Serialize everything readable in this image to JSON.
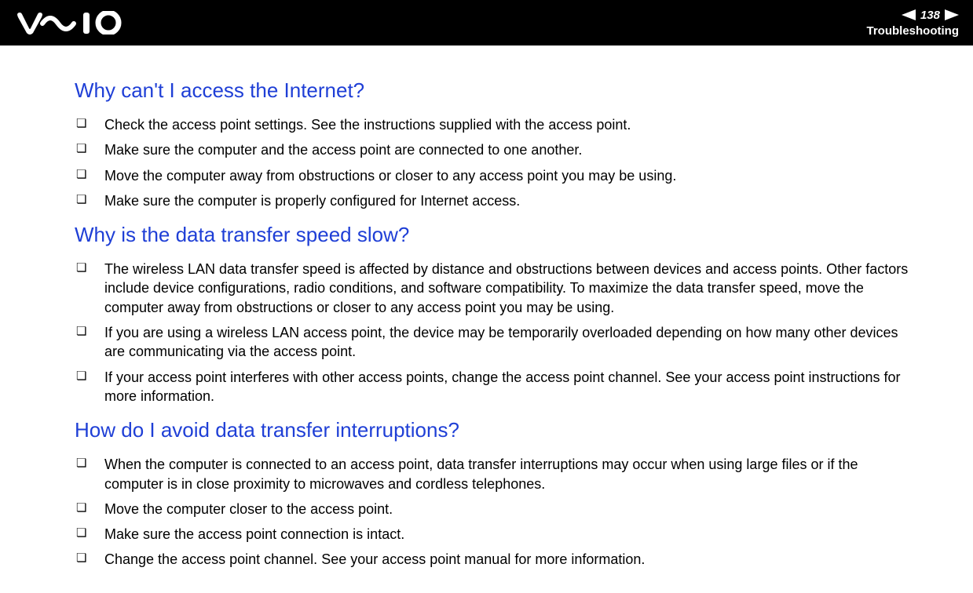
{
  "header": {
    "page_number": "138",
    "section": "Troubleshooting"
  },
  "sections": [
    {
      "heading": "Why can't I access the Internet?",
      "items": [
        "Check the access point settings. See the instructions supplied with the access point.",
        "Make sure the computer and the access point are connected to one another.",
        "Move the computer away from obstructions or closer to any access point you may be using.",
        "Make sure the computer is properly configured for Internet access."
      ]
    },
    {
      "heading": "Why is the data transfer speed slow?",
      "items": [
        "The wireless LAN data transfer speed is affected by distance and obstructions between devices and access points. Other factors include device configurations, radio conditions, and software compatibility. To maximize the data transfer speed, move the computer away from obstructions or closer to any access point you may be using.",
        "If you are using a wireless LAN access point, the device may be temporarily overloaded depending on how many other devices are communicating via the access point.",
        "If your access point interferes with other access points, change the access point channel. See your access point instructions for more information."
      ]
    },
    {
      "heading": "How do I avoid data transfer interruptions?",
      "items": [
        "When the computer is connected to an access point, data transfer interruptions may occur when using large files or if the computer is in close proximity to microwaves and cordless telephones.",
        "Move the computer closer to the access point.",
        "Make sure the access point connection is intact.",
        "Change the access point channel. See your access point manual for more information."
      ]
    }
  ]
}
